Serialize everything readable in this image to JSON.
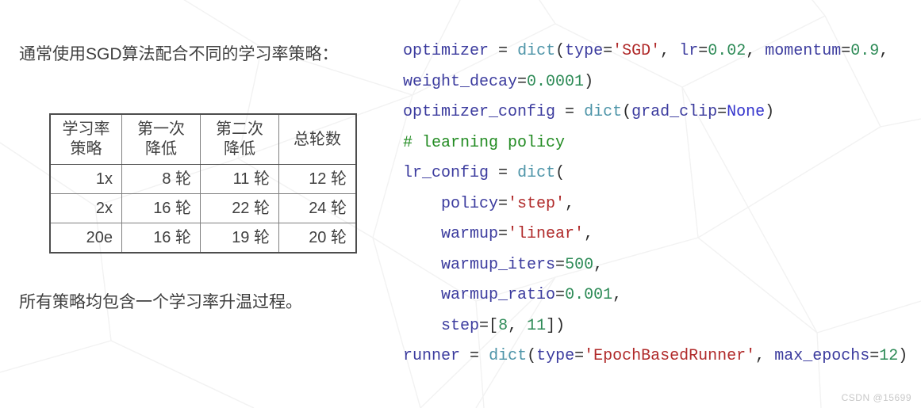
{
  "heading": "通常使用SGD算法配合不同的学习率策略：",
  "note": "所有策略均包含一个学习率升温过程。",
  "watermark": "CSDN @15699",
  "table": {
    "headers": [
      {
        "line1": "学习率",
        "line2": "策略"
      },
      {
        "line1": "第一次",
        "line2": "降低"
      },
      {
        "line1": "第二次",
        "line2": "降低"
      },
      {
        "line1": "总轮数",
        "line2": ""
      }
    ],
    "rows": [
      [
        "1x",
        "8 轮",
        "11 轮",
        "12 轮"
      ],
      [
        "2x",
        "16 轮",
        "22 轮",
        "24 轮"
      ],
      [
        "20e",
        "16 轮",
        "19 轮",
        "20 轮"
      ]
    ]
  },
  "code": {
    "language": "python",
    "lines": [
      [
        {
          "t": "optimizer",
          "c": "name"
        },
        {
          "t": " ",
          "c": "plain"
        },
        {
          "t": "=",
          "c": "op"
        },
        {
          "t": " ",
          "c": "plain"
        },
        {
          "t": "dict",
          "c": "func"
        },
        {
          "t": "(",
          "c": "punct"
        },
        {
          "t": "type",
          "c": "name"
        },
        {
          "t": "=",
          "c": "op"
        },
        {
          "t": "'SGD'",
          "c": "str"
        },
        {
          "t": ",",
          "c": "punct"
        },
        {
          "t": " ",
          "c": "plain"
        },
        {
          "t": "lr",
          "c": "name"
        },
        {
          "t": "=",
          "c": "op"
        },
        {
          "t": "0.02",
          "c": "num"
        },
        {
          "t": ",",
          "c": "punct"
        },
        {
          "t": " ",
          "c": "plain"
        },
        {
          "t": "momentum",
          "c": "name"
        },
        {
          "t": "=",
          "c": "op"
        },
        {
          "t": "0.9",
          "c": "num"
        },
        {
          "t": ",",
          "c": "punct"
        }
      ],
      [
        {
          "t": "weight_decay",
          "c": "name"
        },
        {
          "t": "=",
          "c": "op"
        },
        {
          "t": "0.0001",
          "c": "num"
        },
        {
          "t": ")",
          "c": "punct"
        }
      ],
      [
        {
          "t": "optimizer_config",
          "c": "name"
        },
        {
          "t": " ",
          "c": "plain"
        },
        {
          "t": "=",
          "c": "op"
        },
        {
          "t": " ",
          "c": "plain"
        },
        {
          "t": "dict",
          "c": "func"
        },
        {
          "t": "(",
          "c": "punct"
        },
        {
          "t": "grad_clip",
          "c": "name"
        },
        {
          "t": "=",
          "c": "op"
        },
        {
          "t": "None",
          "c": "kw"
        },
        {
          "t": ")",
          "c": "punct"
        }
      ],
      [
        {
          "t": "# learning policy",
          "c": "comment"
        }
      ],
      [
        {
          "t": "lr_config",
          "c": "name"
        },
        {
          "t": " ",
          "c": "plain"
        },
        {
          "t": "=",
          "c": "op"
        },
        {
          "t": " ",
          "c": "plain"
        },
        {
          "t": "dict",
          "c": "func"
        },
        {
          "t": "(",
          "c": "punct"
        }
      ],
      [
        {
          "t": "    ",
          "c": "plain"
        },
        {
          "t": "policy",
          "c": "name"
        },
        {
          "t": "=",
          "c": "op"
        },
        {
          "t": "'step'",
          "c": "str"
        },
        {
          "t": ",",
          "c": "punct"
        }
      ],
      [
        {
          "t": "    ",
          "c": "plain"
        },
        {
          "t": "warmup",
          "c": "name"
        },
        {
          "t": "=",
          "c": "op"
        },
        {
          "t": "'linear'",
          "c": "str"
        },
        {
          "t": ",",
          "c": "punct"
        }
      ],
      [
        {
          "t": "    ",
          "c": "plain"
        },
        {
          "t": "warmup_iters",
          "c": "name"
        },
        {
          "t": "=",
          "c": "op"
        },
        {
          "t": "500",
          "c": "num"
        },
        {
          "t": ",",
          "c": "punct"
        }
      ],
      [
        {
          "t": "    ",
          "c": "plain"
        },
        {
          "t": "warmup_ratio",
          "c": "name"
        },
        {
          "t": "=",
          "c": "op"
        },
        {
          "t": "0.001",
          "c": "num"
        },
        {
          "t": ",",
          "c": "punct"
        }
      ],
      [
        {
          "t": "    ",
          "c": "plain"
        },
        {
          "t": "step",
          "c": "name"
        },
        {
          "t": "=",
          "c": "op"
        },
        {
          "t": "[",
          "c": "punct"
        },
        {
          "t": "8",
          "c": "num"
        },
        {
          "t": ",",
          "c": "punct"
        },
        {
          "t": " ",
          "c": "plain"
        },
        {
          "t": "11",
          "c": "num"
        },
        {
          "t": "])",
          "c": "punct"
        }
      ],
      [
        {
          "t": "runner",
          "c": "name"
        },
        {
          "t": " ",
          "c": "plain"
        },
        {
          "t": "=",
          "c": "op"
        },
        {
          "t": " ",
          "c": "plain"
        },
        {
          "t": "dict",
          "c": "func"
        },
        {
          "t": "(",
          "c": "punct"
        },
        {
          "t": "type",
          "c": "name"
        },
        {
          "t": "=",
          "c": "op"
        },
        {
          "t": "'EpochBasedRunner'",
          "c": "str"
        },
        {
          "t": ",",
          "c": "punct"
        },
        {
          "t": " ",
          "c": "plain"
        },
        {
          "t": "max_epochs",
          "c": "name"
        },
        {
          "t": "=",
          "c": "op"
        },
        {
          "t": "12",
          "c": "num"
        },
        {
          "t": ")",
          "c": "punct"
        }
      ]
    ]
  },
  "colors": {
    "background": "#ffffff",
    "text": "#404040",
    "table_border_outer": "#4d4d4d",
    "table_border_inner": "#808080",
    "code_identifier": "#3b3b9e",
    "code_function": "#4d94a8",
    "code_string": "#b02a2a",
    "code_number": "#2e8b57",
    "code_keyword": "#3333cc",
    "code_comment": "#228b22",
    "watermark": "#c8c8c8",
    "wireframe": "#f3f3f3"
  }
}
